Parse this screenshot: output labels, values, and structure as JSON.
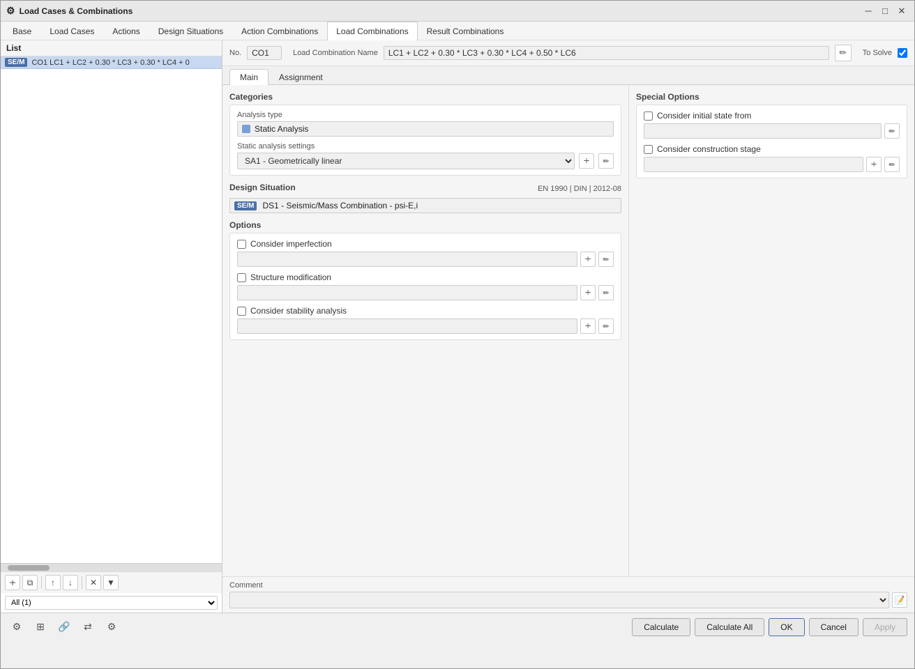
{
  "titleBar": {
    "icon": "⚙",
    "title": "Load Cases & Combinations",
    "minimizeLabel": "─",
    "maximizeLabel": "□",
    "closeLabel": "✕"
  },
  "menuTabs": [
    {
      "id": "base",
      "label": "Base"
    },
    {
      "id": "load-cases",
      "label": "Load Cases"
    },
    {
      "id": "actions",
      "label": "Actions"
    },
    {
      "id": "design-situations",
      "label": "Design Situations"
    },
    {
      "id": "action-combinations",
      "label": "Action Combinations"
    },
    {
      "id": "load-combinations",
      "label": "Load Combinations",
      "active": true
    },
    {
      "id": "result-combinations",
      "label": "Result Combinations"
    }
  ],
  "list": {
    "header": "List",
    "item": {
      "badge": "SE/M",
      "text": "CO1  LC1 + LC2 + 0.30 * LC3 + 0.30 * LC4 + 0"
    }
  },
  "listToolbar": {
    "addBtn": "🞣",
    "copyBtn": "⧉",
    "upBtn": "↑",
    "downBtn": "↓",
    "deleteBtn": "✕",
    "menuBtn": "▼"
  },
  "listFilter": {
    "label": "All (1)",
    "options": [
      "All (1)"
    ]
  },
  "combo": {
    "noLabel": "No.",
    "noValue": "CO1",
    "nameLabel": "Load Combination Name",
    "nameValue": "LC1 + LC2 + 0.30 * LC3 + 0.30 * LC4 + 0.50 * LC6",
    "toSolveLabel": "To Solve",
    "toSolveChecked": true
  },
  "contentTabs": [
    {
      "id": "main",
      "label": "Main",
      "active": true
    },
    {
      "id": "assignment",
      "label": "Assignment"
    }
  ],
  "categories": {
    "title": "Categories",
    "analysisTypeLabel": "Analysis type",
    "analysisTypeValue": "Static Analysis",
    "staticSettingsLabel": "Static analysis settings",
    "staticSettingsValue": "SA1 - Geometrically linear",
    "staticSettingsOptions": [
      "SA1 - Geometrically linear"
    ]
  },
  "designSituation": {
    "title": "Design Situation",
    "norm": "EN 1990 | DIN | 2012-08",
    "badge": "SE/M",
    "value": "DS1 - Seismic/Mass Combination - psi-E,i"
  },
  "options": {
    "title": "Options",
    "imperfection": {
      "label": "Consider imperfection",
      "checked": false
    },
    "structureModification": {
      "label": "Structure modification",
      "checked": false
    },
    "stabilityAnalysis": {
      "label": "Consider stability analysis",
      "checked": false
    }
  },
  "specialOptions": {
    "title": "Special Options",
    "initialState": {
      "label": "Consider initial state from",
      "checked": false
    },
    "constructionStage": {
      "label": "Consider construction stage",
      "checked": false
    }
  },
  "comment": {
    "label": "Comment"
  },
  "bottomButtons": {
    "calculateLabel": "Calculate",
    "calculateAllLabel": "Calculate All",
    "okLabel": "OK",
    "cancelLabel": "Cancel",
    "applyLabel": "Apply"
  }
}
